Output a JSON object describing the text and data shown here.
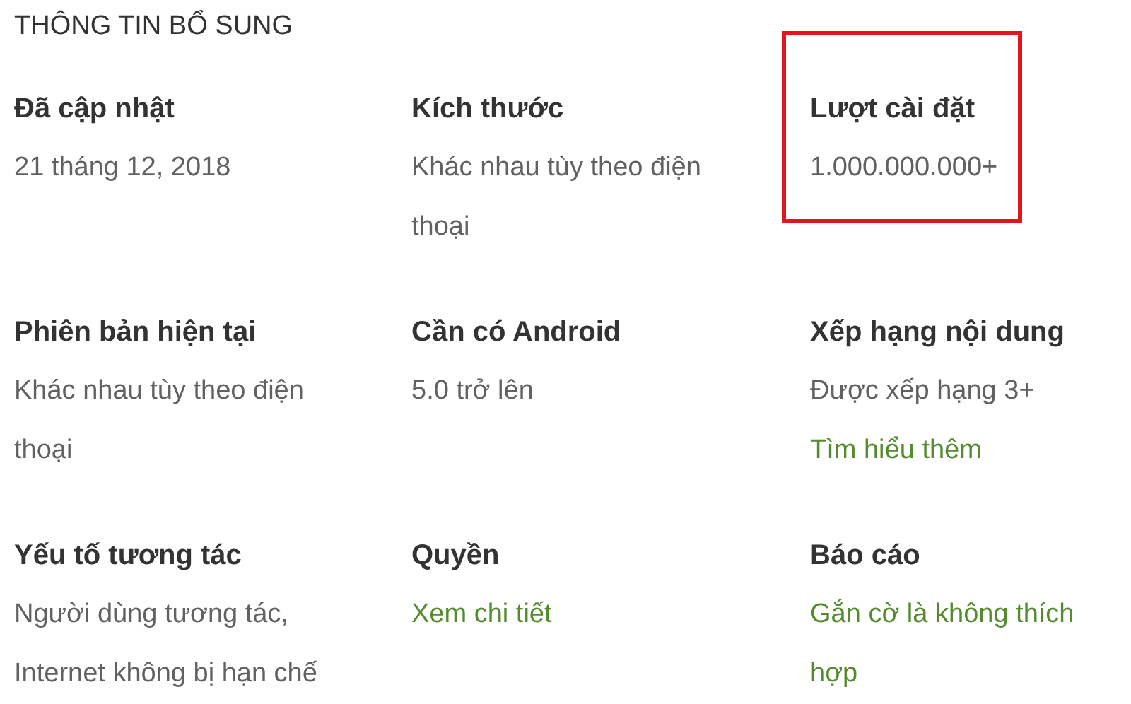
{
  "heading": "THÔNG TIN BỔ SUNG",
  "items": [
    {
      "title": "Đã cập nhật",
      "lines": [
        {
          "kind": "text",
          "text": "21 tháng 12, 2018"
        }
      ],
      "highlighted": false
    },
    {
      "title": "Kích thước",
      "lines": [
        {
          "kind": "text",
          "text": "Khác nhau tùy theo điện thoại"
        }
      ],
      "highlighted": false
    },
    {
      "title": "Lượt cài đặt",
      "lines": [
        {
          "kind": "text",
          "text": "1.000.000.000+"
        }
      ],
      "highlighted": true
    },
    {
      "title": "Phiên bản hiện tại",
      "lines": [
        {
          "kind": "text",
          "text": "Khác nhau tùy theo điện thoại"
        }
      ],
      "highlighted": false
    },
    {
      "title": "Cần có Android",
      "lines": [
        {
          "kind": "text",
          "text": "5.0 trở lên"
        }
      ],
      "highlighted": false
    },
    {
      "title": "Xếp hạng nội dung",
      "lines": [
        {
          "kind": "text",
          "text": "Được xếp hạng 3+"
        },
        {
          "kind": "link",
          "text": "Tìm hiểu thêm"
        }
      ],
      "highlighted": false
    },
    {
      "title": "Yếu tố tương tác",
      "lines": [
        {
          "kind": "text",
          "text": "Người dùng tương tác,"
        },
        {
          "kind": "text",
          "text": "Internet không bị hạn chế"
        }
      ],
      "highlighted": false
    },
    {
      "title": "Quyền",
      "lines": [
        {
          "kind": "link",
          "text": "Xem chi tiết"
        }
      ],
      "highlighted": false
    },
    {
      "title": "Báo cáo",
      "lines": [
        {
          "kind": "link",
          "text": "Gắn cờ là không thích hợp"
        }
      ],
      "highlighted": false
    }
  ]
}
